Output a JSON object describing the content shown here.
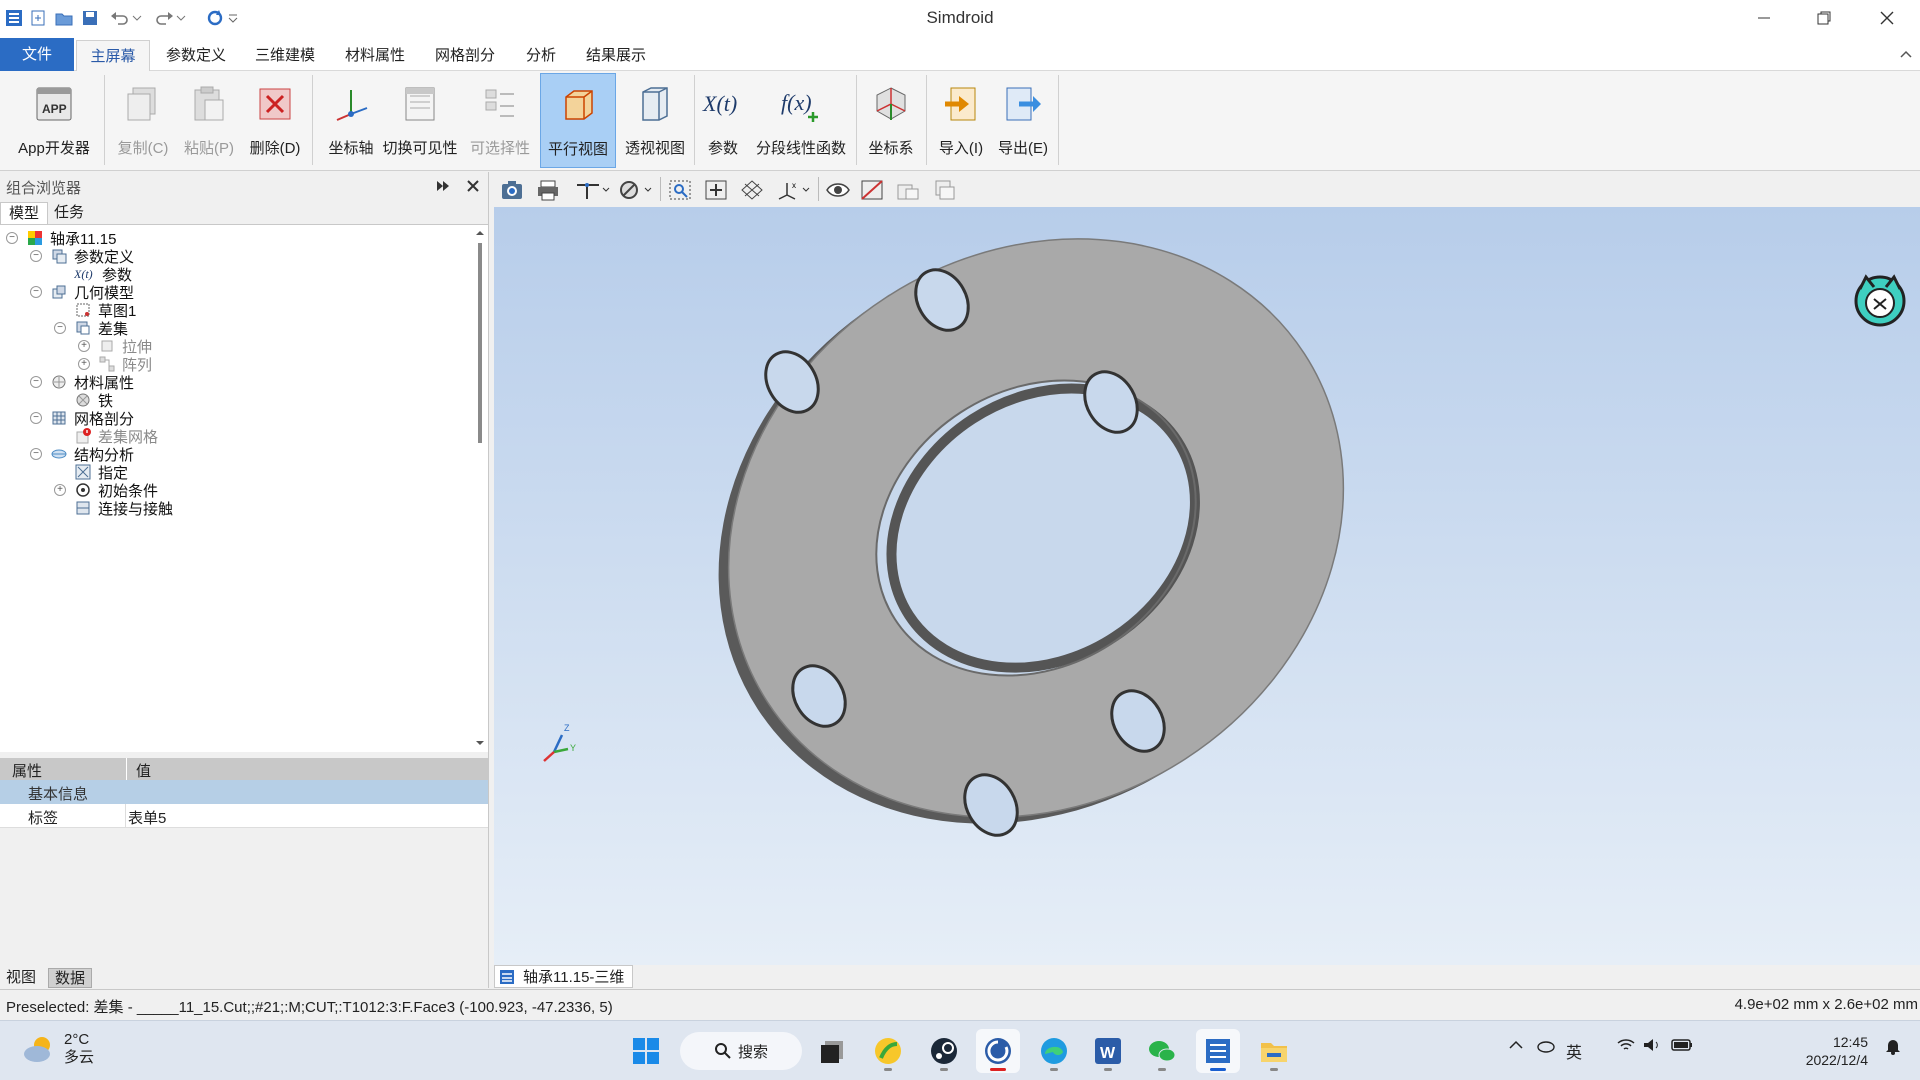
{
  "window": {
    "title": "Simdroid"
  },
  "menu": {
    "file": "文件",
    "tabs": [
      "主屏幕",
      "参数定义",
      "三维建模",
      "材料属性",
      "网格剖分",
      "分析",
      "结果展示"
    ]
  },
  "ribbon": {
    "app_dev": "App开发器",
    "copy": "复制(C)",
    "paste": "粘贴(P)",
    "delete": "删除(D)",
    "axis": "坐标轴",
    "toggle_visibility": "切换可见性",
    "selectability": "可选择性",
    "parallel_view": "平行视图",
    "perspective_view": "透视视图",
    "params": "参数",
    "piecewise_fn": "分段线性函数",
    "coord_system": "坐标系",
    "import": "导入(I)",
    "export": "导出(E)"
  },
  "left_panel": {
    "title": "组合浏览器",
    "tabs": [
      "模型",
      "任务"
    ],
    "tree": {
      "root": "轴承11.15",
      "param_def": "参数定义",
      "params": "参数",
      "geometry": "几何模型",
      "sketch": "草图1",
      "diff": "差集",
      "extrude": "拉伸",
      "array": "阵列",
      "material": "材料属性",
      "iron": "铁",
      "mesh": "网格剖分",
      "diff_mesh": "差集网格",
      "struct": "结构分析",
      "assign": "指定",
      "init_cond": "初始条件",
      "contact": "连接与接触"
    },
    "props": {
      "col_prop": "属性",
      "col_val": "值",
      "group": "基本信息",
      "row_label": "标签",
      "row_value": "表单5"
    },
    "bottom_tabs": [
      "视图",
      "数据"
    ]
  },
  "document_tab": "轴承11.15-三维",
  "axis_labels": {
    "z": "Z",
    "y": "Y"
  },
  "status": {
    "left": "Preselected: 差集 - _____11_15.Cut;;#21;:M;CUT;:T1012:3:F.Face3 (-100.923, -47.2336, 5)",
    "right": "4.9e+02 mm x 2.6e+02 mm"
  },
  "taskbar": {
    "weather_temp": "2°C",
    "weather_desc": "多云",
    "search": "搜索",
    "ime": "英",
    "time": "12:45",
    "date": "2022/12/4"
  },
  "colors": {
    "accent": "#2b6cc4",
    "part": "#a9a9a9",
    "viewport_top": "#b7cdea"
  }
}
